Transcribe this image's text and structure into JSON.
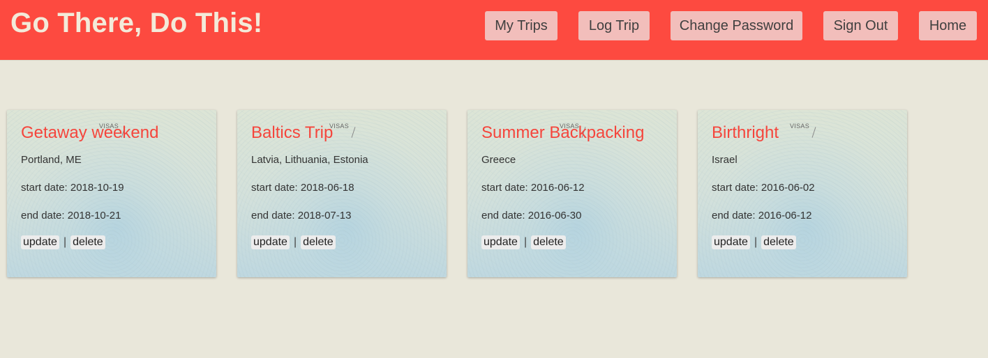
{
  "header": {
    "brand": "Go There, Do This!",
    "nav": [
      "My Trips",
      "Log Trip",
      "Change Password",
      "Sign Out",
      "Home"
    ]
  },
  "colors": {
    "header_bg": "#fd4a40",
    "nav_button_bg": "#f2bebb",
    "page_bg": "#e9e7da",
    "card_title": "#f5453c"
  },
  "trips": [
    {
      "title": "Getaway weekend",
      "location": "Portland, ME",
      "start": "start date: 2018-10-19",
      "end": "end date: 2018-10-21",
      "stamp": "VISAS",
      "update": "update",
      "separator": "|",
      "delete": "delete"
    },
    {
      "title": "Baltics Trip",
      "location": "Latvia, Lithuania, Estonia",
      "start": "start date: 2018-06-18",
      "end": "end date: 2018-07-13",
      "stamp": "VISAS",
      "update": "update",
      "separator": "|",
      "delete": "delete"
    },
    {
      "title": "Summer Backpacking",
      "location": "Greece",
      "start": "start date: 2016-06-12",
      "end": "end date: 2016-06-30",
      "stamp": "VISAS",
      "update": "update",
      "separator": "|",
      "delete": "delete"
    },
    {
      "title": "Birthright",
      "location": "Israel",
      "start": "start date: 2016-06-02",
      "end": "end date: 2016-06-12",
      "stamp": "VISAS",
      "update": "update",
      "separator": "|",
      "delete": "delete"
    }
  ]
}
